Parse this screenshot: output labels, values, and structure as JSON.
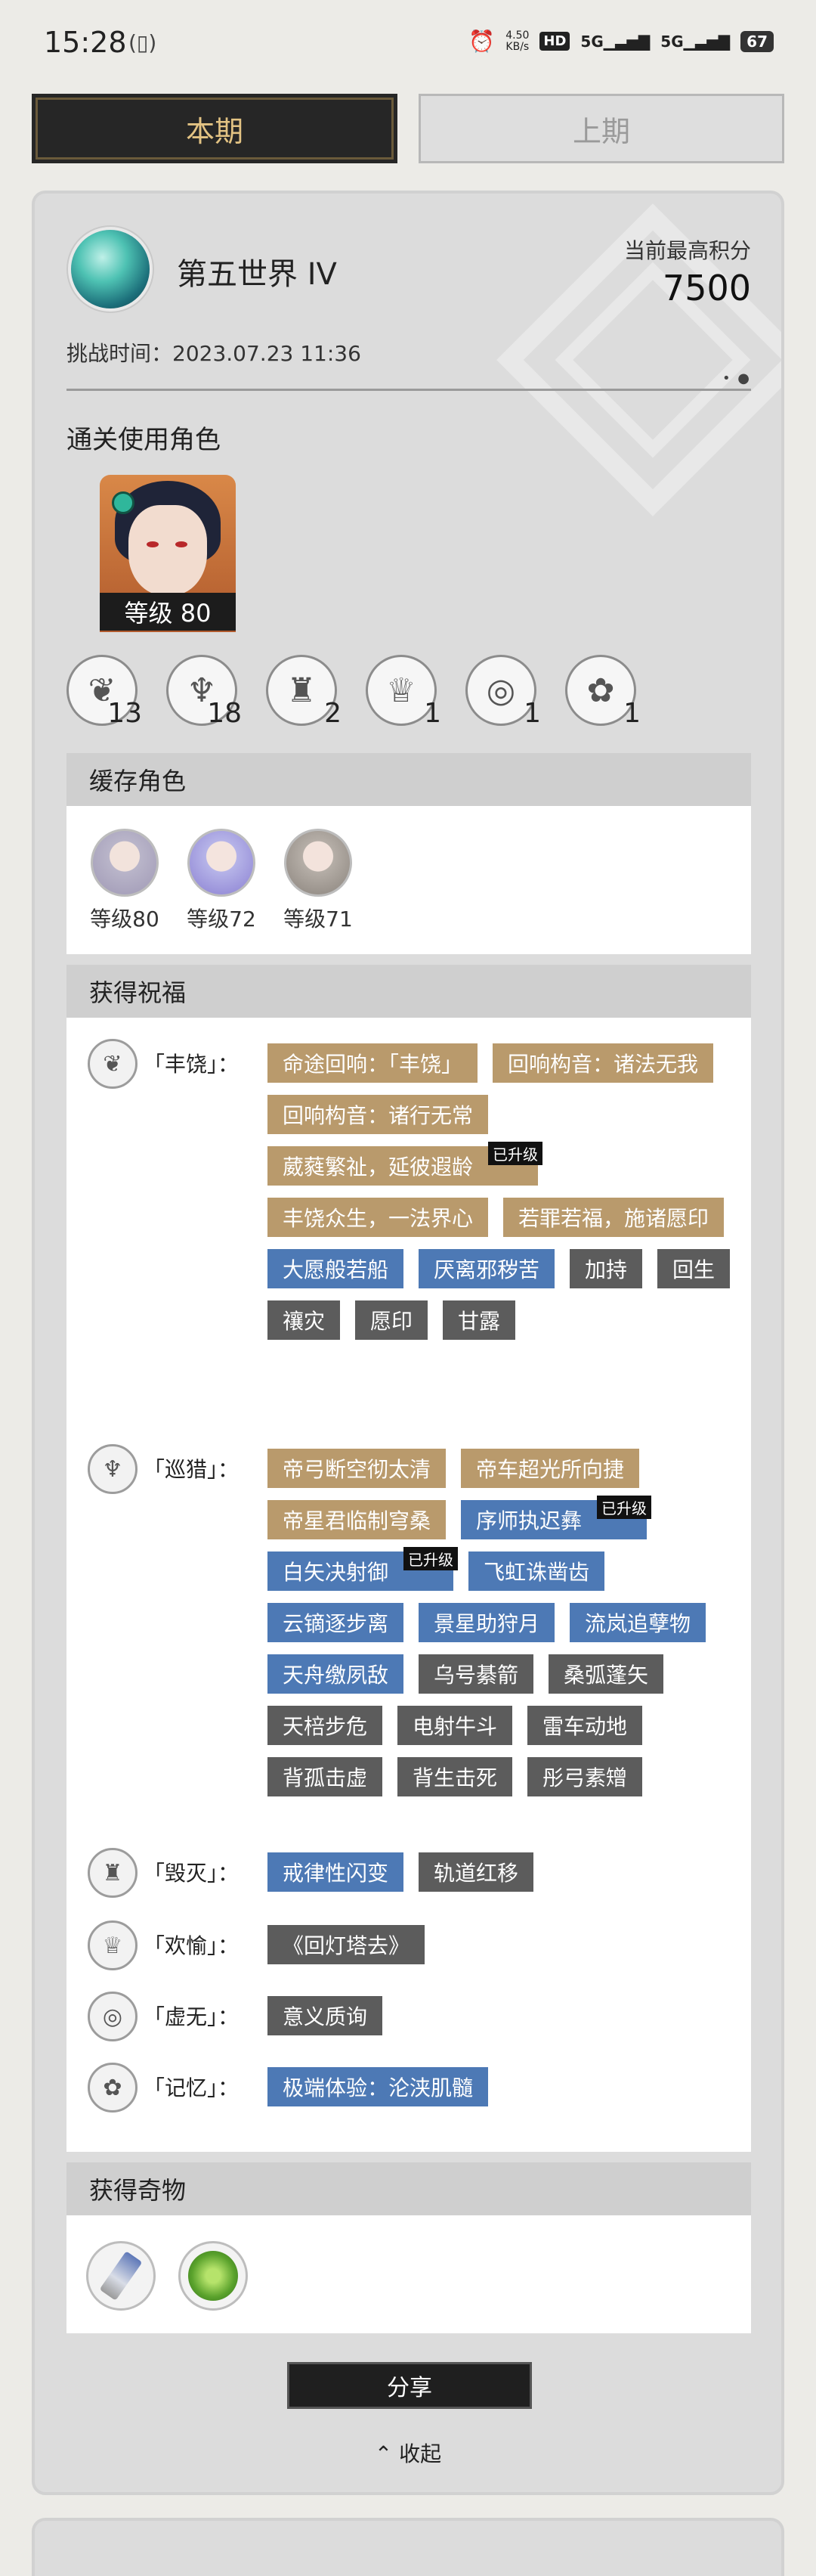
{
  "status_bar": {
    "time": "15:28",
    "net_speed": "4.50\nKB/s",
    "hd": "HD",
    "sig1": "5G",
    "sig2": "5G",
    "battery": "67"
  },
  "tabs": {
    "current": "本期",
    "previous": "上期"
  },
  "header": {
    "world": "第五世界 IV",
    "score_label": "当前最高积分",
    "score": "7500",
    "challenge_time": "挑战时间：2023.07.23 11:36"
  },
  "used_characters": {
    "title": "通关使用角色",
    "main_level": "等级 80"
  },
  "path_counts": [
    {
      "icon": "abundance-icon",
      "count": "13"
    },
    {
      "icon": "hunt-icon",
      "count": "18"
    },
    {
      "icon": "destruction-icon",
      "count": "2"
    },
    {
      "icon": "elation-icon",
      "count": "1"
    },
    {
      "icon": "nihility-icon",
      "count": "1"
    },
    {
      "icon": "remembrance-icon",
      "count": "1"
    }
  ],
  "cached": {
    "title": "缓存角色",
    "levels": [
      "等级80",
      "等级72",
      "等级71"
    ]
  },
  "blessings": {
    "title": "获得祝福",
    "upgraded_tag": "已升级",
    "groups": [
      {
        "name": "「丰饶」：",
        "chips": [
          {
            "text": "命途回响：「丰饶」",
            "color": "gold",
            "upgraded": false
          },
          {
            "text": "回响构音：诸法无我",
            "color": "gold",
            "upgraded": false
          },
          {
            "text": "回响构音：诸行无常",
            "color": "gold",
            "upgraded": false
          },
          {
            "text": "葳蕤繁祉，延彼遐龄",
            "color": "gold",
            "upgraded": true
          },
          {
            "text": "丰饶众生，一法界心",
            "color": "gold",
            "upgraded": false
          },
          {
            "text": "若罪若福，施诸愿印",
            "color": "gold",
            "upgraded": false
          },
          {
            "text": "大愿般若船",
            "color": "blue",
            "upgraded": false
          },
          {
            "text": "厌离邪秽苦",
            "color": "blue",
            "upgraded": false
          },
          {
            "text": "加持",
            "color": "gray",
            "upgraded": false
          },
          {
            "text": "回生",
            "color": "gray",
            "upgraded": false
          },
          {
            "text": "禳灾",
            "color": "gray",
            "upgraded": false
          },
          {
            "text": "愿印",
            "color": "gray",
            "upgraded": false
          },
          {
            "text": "甘露",
            "color": "gray",
            "upgraded": false
          }
        ]
      },
      {
        "name": "「巡猎」：",
        "chips": [
          {
            "text": "帝弓断空彻太清",
            "color": "gold",
            "upgraded": false
          },
          {
            "text": "帝车超光所向捷",
            "color": "gold",
            "upgraded": false
          },
          {
            "text": "帝星君临制穹桑",
            "color": "gold",
            "upgraded": false
          },
          {
            "text": "序师执迟彝",
            "color": "blue",
            "upgraded": true
          },
          {
            "text": "白矢决射御",
            "color": "blue",
            "upgraded": true
          },
          {
            "text": "飞虹诛凿齿",
            "color": "blue",
            "upgraded": false
          },
          {
            "text": "云镝逐步离",
            "color": "blue",
            "upgraded": false
          },
          {
            "text": "景星助狩月",
            "color": "blue",
            "upgraded": false
          },
          {
            "text": "流岚追孽物",
            "color": "blue",
            "upgraded": false
          },
          {
            "text": "天舟缴夙敌",
            "color": "blue",
            "upgraded": false
          },
          {
            "text": "乌号綦箭",
            "color": "gray",
            "upgraded": false
          },
          {
            "text": "桑弧蓬矢",
            "color": "gray",
            "upgraded": false
          },
          {
            "text": "天棓步危",
            "color": "gray",
            "upgraded": false
          },
          {
            "text": "电射牛斗",
            "color": "gray",
            "upgraded": false
          },
          {
            "text": "雷车动地",
            "color": "gray",
            "upgraded": false
          },
          {
            "text": "背孤击虚",
            "color": "gray",
            "upgraded": false
          },
          {
            "text": "背生击死",
            "color": "gray",
            "upgraded": false
          },
          {
            "text": "彤弓素矰",
            "color": "gray",
            "upgraded": false
          }
        ]
      },
      {
        "name": "「毁灭」：",
        "chips": [
          {
            "text": "戒律性闪变",
            "color": "blue",
            "upgraded": false
          },
          {
            "text": "轨道红移",
            "color": "gray",
            "upgraded": false
          }
        ]
      },
      {
        "name": "「欢愉」：",
        "chips": [
          {
            "text": "《回灯塔去》",
            "color": "gray",
            "upgraded": false
          }
        ]
      },
      {
        "name": "「虚无」：",
        "chips": [
          {
            "text": "意义质询",
            "color": "gray",
            "upgraded": false
          }
        ]
      },
      {
        "name": "「记忆」：",
        "chips": [
          {
            "text": "极端体验：沦浃肌髓",
            "color": "blue",
            "upgraded": false
          }
        ]
      }
    ]
  },
  "curios": {
    "title": "获得奇物"
  },
  "actions": {
    "share": "分享",
    "collapse": "收起"
  },
  "colors": {
    "gold": "#b99a6c",
    "blue": "#4d79b5",
    "gray": "#5c5c5c",
    "tab_active_text": "#e3c383"
  }
}
